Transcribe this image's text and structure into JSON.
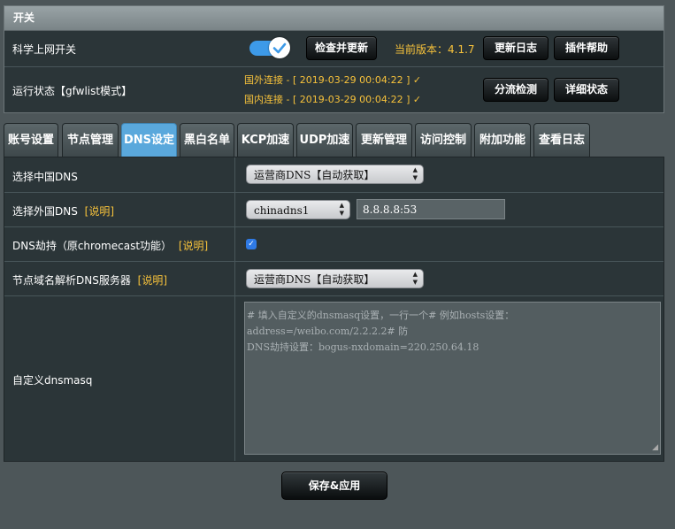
{
  "section": {
    "title": "开关"
  },
  "switch_row": {
    "label": "科学上网开关",
    "check_update_label": "检查并更新",
    "version_text": "当前版本：4.1.7",
    "changelog_label": "更新日志",
    "plugin_help_label": "插件帮助",
    "toggle_state": "on"
  },
  "status_row": {
    "label": "运行状态【gfwlist模式】",
    "foreign_status": "国外连接 - [ 2019-03-29 00:04:22 ] ✓",
    "domestic_status": "国内连接 - [ 2019-03-29 00:04:22 ] ✓",
    "split_detect_label": "分流检测",
    "detail_status_label": "详细状态"
  },
  "tabs": [
    {
      "label": "账号设置"
    },
    {
      "label": "节点管理"
    },
    {
      "label": "DNS设定"
    },
    {
      "label": "黑白名单"
    },
    {
      "label": "KCP加速"
    },
    {
      "label": "UDP加速"
    },
    {
      "label": "更新管理"
    },
    {
      "label": "访问控制"
    },
    {
      "label": "附加功能"
    },
    {
      "label": "查看日志"
    }
  ],
  "active_tab": "DNS设定",
  "dns": {
    "china_dns": {
      "label": "选择中国DNS",
      "value": "运营商DNS【自动获取】"
    },
    "foreign_dns": {
      "label": "选择外国DNS",
      "explain": "[说明]",
      "value": "chinadns1",
      "server": "8.8.8.8:53"
    },
    "dns_hijack": {
      "label": "DNS劫持（原chromecast功能）",
      "explain": "[说明]",
      "checked": true
    },
    "node_resolve": {
      "label": "节点域名解析DNS服务器",
      "explain": "[说明]",
      "value": "运营商DNS【自动获取】"
    },
    "custom_dnsmasq": {
      "label": "自定义dnsmasq",
      "placeholder_line1": "# 填入自定义的dnsmasq设置，一行一个# 例如hosts设置：address=/weibo.com/2.2.2.2# 防",
      "placeholder_line2": "DNS劫持设置：bogus-nxdomain=220.250.64.18"
    }
  },
  "save_label": "保存&应用",
  "colors": {
    "accent": "#5aa8dc",
    "toggle": "#3d9ae8",
    "status_yellow": "#f7c23b",
    "panel": "#2b3538",
    "background": "#4d5659"
  }
}
